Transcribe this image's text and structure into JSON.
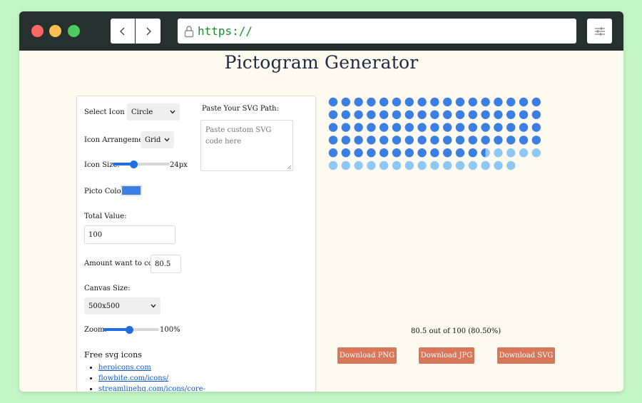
{
  "browser": {
    "url": "https://"
  },
  "page": {
    "title": "Pictogram Generator"
  },
  "controls": {
    "select_icon_label": "Select Icon or:",
    "select_icon_value": "Circle",
    "arrangement_label": "Icon Arrangement:",
    "arrangement_value": "Grid",
    "icon_size_label": "Icon Size:",
    "icon_size_value": "24px",
    "icon_size_fraction": 0.37,
    "picto_color_label": "Picto Color:",
    "picto_color": "#3b7fe3",
    "total_value_label": "Total Value:",
    "total_value": "100",
    "amount_label": "Amount want to color:",
    "amount_value": "80.5",
    "canvas_size_label": "Canvas Size:",
    "canvas_size_value": "500x500",
    "zoom_label": "Zoom:",
    "zoom_value": "100%",
    "zoom_fraction": 0.47,
    "svg_path_label": "Paste Your SVG Path:",
    "svg_path_placeholder": "Paste custom SVG code here"
  },
  "free_icons": {
    "title": "Free svg icons",
    "links": [
      "heroicons.com",
      "flowbite.com/icons/",
      "streamlinehq.com/icons/core-"
    ]
  },
  "pictogram": {
    "total": 100,
    "colored": 80.5,
    "columns": 17,
    "filled_color": "#3b7fe3",
    "empty_color": "#8ec8f5"
  },
  "summary": "80.5 out of 100 (80.50%)",
  "downloads": {
    "png": "Download PNG",
    "jpg": "Download JPG",
    "svg": "Download SVG"
  },
  "colors": {
    "accent": "#1f6fe0",
    "button": "#d6775a",
    "titlebar": "#26302e",
    "page_bg": "#fffaf0"
  }
}
